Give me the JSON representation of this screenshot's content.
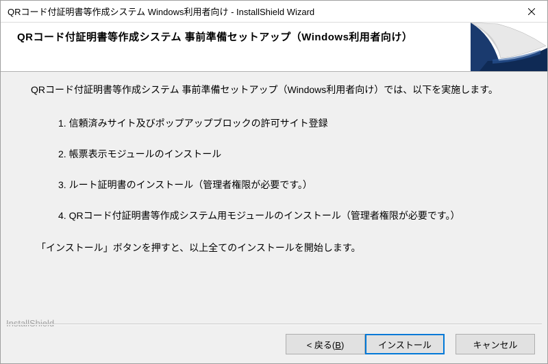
{
  "window": {
    "title": "QRコード付証明書等作成システム Windows利用者向け - InstallShield Wizard"
  },
  "header": {
    "title": "QRコード付証明書等作成システム 事前準備セットアップ（Windows利用者向け）"
  },
  "content": {
    "intro": "QRコード付証明書等作成システム 事前準備セットアップ（Windows利用者向け）では、以下を実施します。",
    "items": [
      "1. 信頼済みサイト及びポップアップブロックの許可サイト登録",
      "2. 帳票表示モジュールのインストール",
      "3. ルート証明書のインストール（管理者権限が必要です。）",
      "4. QRコード付証明書等作成システム用モジュールのインストール（管理者権限が必要です。）"
    ],
    "footer": "「インストール」ボタンを押すと、以上全てのインストールを開始します。"
  },
  "brand": {
    "label": "InstallShield"
  },
  "buttons": {
    "back_prefix": "< 戻る(",
    "back_key": "B",
    "back_suffix": ")",
    "install": "インストール",
    "cancel": "キャンセル"
  }
}
